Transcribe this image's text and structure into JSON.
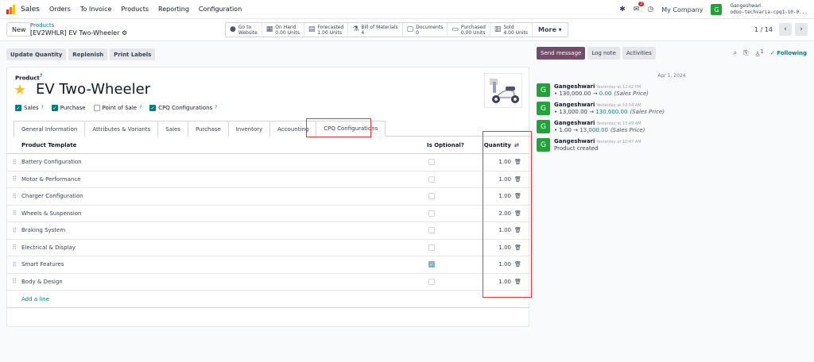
{
  "topnav": {
    "app_name": "Sales",
    "menu": [
      "Orders",
      "To Invoice",
      "Products",
      "Reporting",
      "Configuration"
    ],
    "messages_count": "2",
    "company": "My Company",
    "user_initial": "G",
    "user_name": "Gangeshwari",
    "database": "odoo-techvaria-cpq1-10-0..."
  },
  "controlbar": {
    "new_label": "New",
    "breadcrumb_parent": "Products",
    "breadcrumb_current": "[EV2WHLR] EV Two-Wheeler",
    "smart_buttons": [
      {
        "icon": "globe-icon",
        "glyph": "●",
        "line1": "Go to",
        "line2": "Website"
      },
      {
        "icon": "cubes-icon",
        "glyph": "▦",
        "line1": "On Hand",
        "line2": "0.00 Units"
      },
      {
        "icon": "chart-icon",
        "glyph": "▤",
        "line1": "Forecasted",
        "line2": "1.00 Units"
      },
      {
        "icon": "flask-icon",
        "glyph": "⚗",
        "line1": "Bill of Materials",
        "line2": "4"
      },
      {
        "icon": "file-icon",
        "glyph": "▢",
        "line1": "Documents",
        "line2": "0"
      },
      {
        "icon": "credit-card-icon",
        "glyph": "▭",
        "line1": "Purchased",
        "line2": "0.00 Units"
      },
      {
        "icon": "signal-icon",
        "glyph": "▥",
        "line1": "Sold",
        "line2": "4.00 Units"
      }
    ],
    "more_label": "More",
    "pager": "1 / 14"
  },
  "statusbar": {
    "buttons": [
      "Update Quantity",
      "Replenish",
      "Print Labels"
    ]
  },
  "form": {
    "product_label": "Product",
    "product_name": "EV Two-Wheeler",
    "checkboxes": [
      {
        "label": "Sales",
        "checked": true
      },
      {
        "label": "Purchase",
        "checked": true
      },
      {
        "label": "Point of Sale",
        "checked": false
      },
      {
        "label": "CPQ Configurations",
        "checked": true
      }
    ],
    "tabs": [
      "General Information",
      "Attributes & Variants",
      "Sales",
      "Purchase",
      "Inventory",
      "Accounting",
      "CPQ Configurations"
    ],
    "active_tab": "CPQ Configurations",
    "table": {
      "headers": {
        "template": "Product Template",
        "optional": "Is Optional?",
        "quantity": "Quantity"
      },
      "rows": [
        {
          "template": "Battery Configuration",
          "optional": false,
          "quantity": "1.00"
        },
        {
          "template": "Motor & Performance",
          "optional": false,
          "quantity": "1.00"
        },
        {
          "template": "Charger Configuration",
          "optional": false,
          "quantity": "1.00"
        },
        {
          "template": "Wheels & Suspension",
          "optional": false,
          "quantity": "2.00"
        },
        {
          "template": "Braking System",
          "optional": false,
          "quantity": "1.00"
        },
        {
          "template": "Electrical & Display",
          "optional": false,
          "quantity": "1.00"
        },
        {
          "template": "Smart Features",
          "optional": true,
          "quantity": "1.00"
        },
        {
          "template": "Body & Design",
          "optional": false,
          "quantity": "1.00"
        }
      ],
      "add_line": "Add a line"
    }
  },
  "chatter": {
    "send_message": "Send message",
    "log_note": "Log note",
    "activities": "Activities",
    "followers_count": "1",
    "following": "Following",
    "date": "Apr 1, 2024",
    "messages": [
      {
        "author": "Gangeshwari",
        "time": "Yesterday at 12:42 PM",
        "old": "130,000.00",
        "new": "0.00",
        "field": "(Sales Price)"
      },
      {
        "author": "Gangeshwari",
        "time": "Yesterday at 10:54 AM",
        "old": "13,000.00",
        "new": "130,000.00",
        "field": "(Sales Price)"
      },
      {
        "author": "Gangeshwari",
        "time": "Yesterday at 10:49 AM",
        "old": "1.00",
        "new": "13,000.00",
        "field": "(Sales Price)"
      },
      {
        "author": "Gangeshwari",
        "time": "Yesterday at 10:47 AM",
        "text": "Product created"
      }
    ]
  },
  "colors": {
    "brand": "#714b67",
    "teal": "#017e84",
    "highlight": "#e23b3b",
    "star": "#f3c318"
  }
}
